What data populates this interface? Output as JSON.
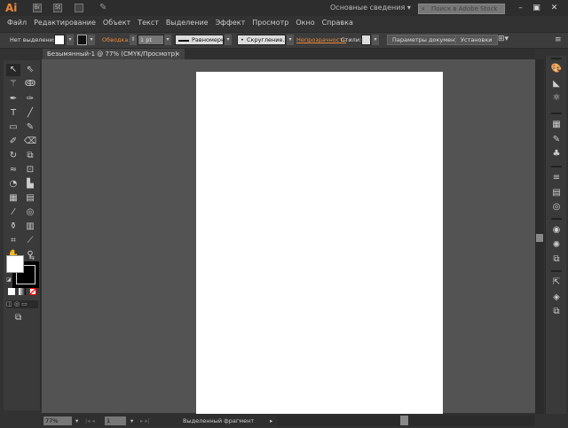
{
  "app": {
    "logo": "Ai",
    "workspace": "Основные сведения",
    "stock_placeholder": "Поиск в Adobe Stock",
    "br": "Br",
    "st": "St"
  },
  "menu": [
    "Файл",
    "Редактирование",
    "Объект",
    "Текст",
    "Выделение",
    "Эффект",
    "Просмотр",
    "Окно",
    "Справка"
  ],
  "control": {
    "selection": "Нет выделения",
    "stroke_label": "Обводка:",
    "stroke_value": "1 pt",
    "profile": "Равномерно",
    "brush": "Скругление...",
    "opacity": "Непрозрачность",
    "styles": "Стили:",
    "doc_settings": "Параметры документа",
    "prefs": "Установки"
  },
  "document": {
    "tab": "Безымянный-1 @ 77% (CMYK/Просмотр)",
    "close": "×"
  },
  "status": {
    "zoom": "77%",
    "page": "1",
    "info": "Выделенный фрагмент"
  },
  "colors": {
    "accent": "#e8883a",
    "canvas": "#535353",
    "ui": "#3a3a3a"
  }
}
